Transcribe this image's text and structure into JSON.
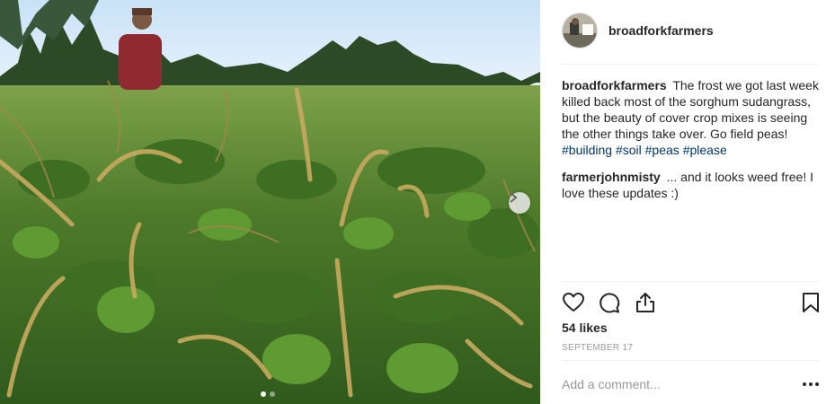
{
  "post": {
    "username": "broadforkfarmers",
    "likes": "54 likes",
    "date": "SEPTEMBER 17",
    "add_comment_placeholder": "Add a comment...",
    "carousel": {
      "total": 2,
      "current": 1
    }
  },
  "comments": [
    {
      "author": "broadforkfarmers",
      "text": "The frost we got last week killed back most of the sorghum sudangrass, but the beauty of cover crop mixes is seeing the other things take over. Go field peas!",
      "hashtags": [
        "#building",
        "#soil",
        "#peas",
        "#please"
      ]
    },
    {
      "author": "farmerjohnmisty",
      "text": "... and it looks weed free! I love these updates :)",
      "hashtags": []
    }
  ],
  "icons": {
    "like": "heart-icon",
    "comment": "comment-icon",
    "share": "share-icon",
    "save": "bookmark-icon",
    "more": "more-options-icon",
    "next": "chevron-right-icon"
  },
  "colors": {
    "text": "#262626",
    "hashtag": "#003569",
    "muted": "#999999",
    "divider": "#efefef"
  }
}
